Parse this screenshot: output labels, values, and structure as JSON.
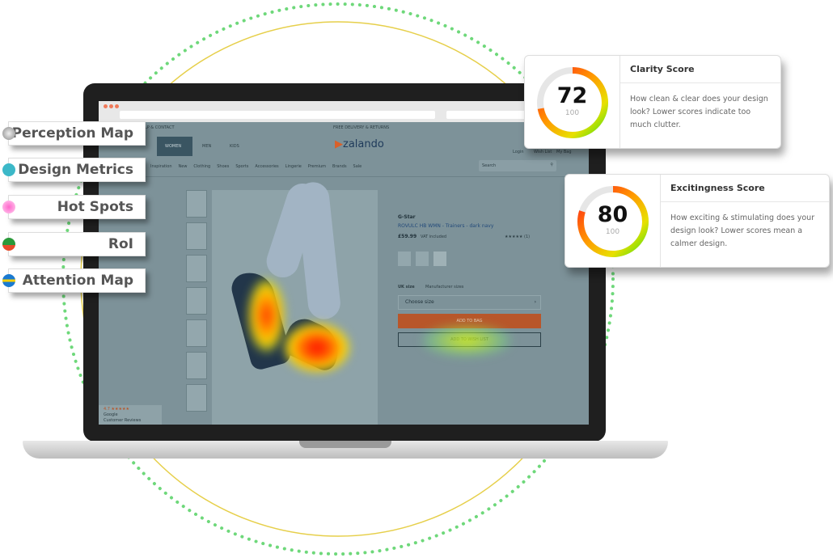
{
  "colors": {
    "ring_dotted": "#6ed87a",
    "ring_solid": "#e6cf4a",
    "site_overlay": "#7d9299",
    "add_to_bag": "#b8562a"
  },
  "tabs": [
    {
      "label": "Perception Map",
      "icon": "perception-map-icon"
    },
    {
      "label": "Design Metrics",
      "icon": "design-metrics-icon"
    },
    {
      "label": "Hot Spots",
      "icon": "hot-spots-icon"
    },
    {
      "label": "RoI",
      "icon": "roi-icon"
    },
    {
      "label": "Attention Map",
      "icon": "attention-map-icon"
    }
  ],
  "cards": [
    {
      "title": "Clarity Score",
      "score": "72",
      "max": "100",
      "score_value": 72,
      "description": "How clean & clear does your design look? Lower scores indicate too much clutter."
    },
    {
      "title": "Excitingness Score",
      "score": "80",
      "max": "100",
      "score_value": 80,
      "description": "How exciting & stimulating does your design look? Lower scores mean a calmer design."
    }
  ],
  "site": {
    "help": "HELP & CONTACT",
    "delivery": "FREE DELIVERY & RETURNS",
    "logo": "zalando",
    "gender_tabs": [
      "WOMEN",
      "MEN",
      "KIDS"
    ],
    "account": [
      "Login",
      "Wish List",
      "My Bag"
    ],
    "nav": [
      "Inspiration",
      "New",
      "Clothing",
      "Shoes",
      "Sports",
      "Accessories",
      "Lingerie",
      "Premium",
      "Brands",
      "Sale"
    ],
    "search_placeholder": "Search",
    "brand": "G-Star",
    "product": "ROVULC HB WMN - Trainers - dark navy",
    "price": "£59.99",
    "vat": "VAT included",
    "rating": "★★★★★ (1)",
    "size_label": "UK size",
    "manufacturer_sizes": "Manufacturer sizes",
    "choose_size": "Choose size",
    "add_to_bag": "ADD TO BAG",
    "add_to_wishlist": "ADD TO WISH LIST",
    "review_score": "4.7 ★★★★★",
    "review_source": "Google",
    "review_label": "Customer Reviews"
  }
}
